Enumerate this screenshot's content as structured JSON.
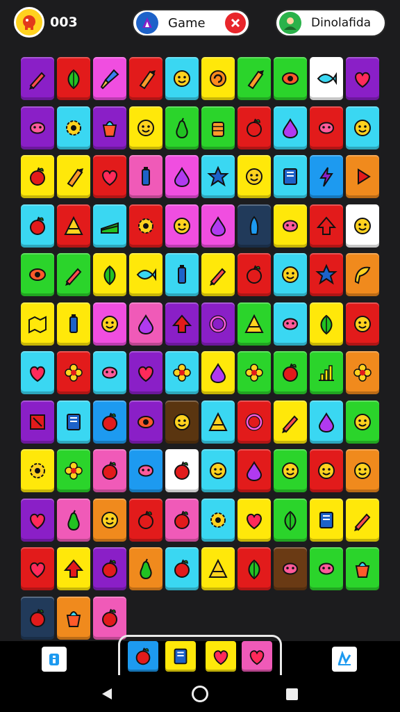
{
  "header": {
    "score": "003",
    "game_label": "Game",
    "user_label": "Dinolafida"
  },
  "palette": {
    "purple": "#8a1fc7",
    "red": "#e21b1b",
    "magenta": "#f04ee0",
    "cyan": "#3ad7f2",
    "yellow": "#ffe80a",
    "green": "#2bd42b",
    "white": "#ffffff",
    "blue": "#1d9af0",
    "orange": "#f08a1d",
    "pink": "#f05ab8",
    "dark": "#213a5a",
    "brown": "#5a3510",
    "olive": "#6a3a14"
  },
  "board": {
    "rows": [
      [
        [
          "purple",
          "pencil"
        ],
        [
          "red",
          "leaf"
        ],
        [
          "magenta",
          "brush"
        ],
        [
          "red",
          "crayon"
        ],
        [
          "cyan",
          "face"
        ],
        [
          "yellow",
          "swirl"
        ],
        [
          "green",
          "crayon"
        ],
        [
          "green",
          "eye"
        ],
        [
          "white",
          "fish"
        ],
        [
          "purple",
          "heart"
        ]
      ],
      [
        [
          "purple",
          "blob"
        ],
        [
          "cyan",
          "gear"
        ],
        [
          "purple",
          "pot"
        ],
        [
          "yellow",
          "face"
        ],
        [
          "green",
          "pear"
        ],
        [
          "green",
          "fist"
        ],
        [
          "red",
          "apple"
        ],
        [
          "cyan",
          "drop"
        ],
        [
          "red",
          "blob"
        ],
        [
          "cyan",
          "face"
        ]
      ],
      [
        [
          "yellow",
          "apple"
        ],
        [
          "yellow",
          "crayon"
        ],
        [
          "red",
          "heart"
        ],
        [
          "pink",
          "bottle"
        ],
        [
          "magenta",
          "drop"
        ],
        [
          "cyan",
          "star"
        ],
        [
          "yellow",
          "face"
        ],
        [
          "cyan",
          "book"
        ],
        [
          "blue",
          "bolt"
        ],
        [
          "orange",
          "play"
        ]
      ],
      [
        [
          "cyan",
          "apple"
        ],
        [
          "red",
          "cone"
        ],
        [
          "cyan",
          "cake"
        ],
        [
          "red",
          "gear"
        ],
        [
          "magenta",
          "face"
        ],
        [
          "magenta",
          "drop"
        ],
        [
          "dark",
          "rocket"
        ],
        [
          "yellow",
          "blob"
        ],
        [
          "red",
          "arrow"
        ],
        [
          "white",
          "face"
        ]
      ],
      [
        [
          "green",
          "eye"
        ],
        [
          "green",
          "pencil"
        ],
        [
          "yellow",
          "leaf"
        ],
        [
          "yellow",
          "fish"
        ],
        [
          "cyan",
          "bottle"
        ],
        [
          "yellow",
          "pencil"
        ],
        [
          "red",
          "apple"
        ],
        [
          "cyan",
          "face"
        ],
        [
          "red",
          "star"
        ],
        [
          "orange",
          "shell"
        ]
      ],
      [
        [
          "yellow",
          "map"
        ],
        [
          "yellow",
          "bottle"
        ],
        [
          "magenta",
          "face"
        ],
        [
          "pink",
          "drop"
        ],
        [
          "purple",
          "arrow"
        ],
        [
          "purple",
          "ring"
        ],
        [
          "green",
          "cone"
        ],
        [
          "cyan",
          "blob"
        ],
        [
          "yellow",
          "leaf"
        ],
        [
          "red",
          "face"
        ]
      ],
      [
        [
          "cyan",
          "heart"
        ],
        [
          "red",
          "flower"
        ],
        [
          "cyan",
          "blob"
        ],
        [
          "purple",
          "heart"
        ],
        [
          "cyan",
          "flower"
        ],
        [
          "yellow",
          "drop"
        ],
        [
          "green",
          "flower"
        ],
        [
          "green",
          "apple"
        ],
        [
          "green",
          "chart"
        ],
        [
          "orange",
          "flower"
        ]
      ],
      [
        [
          "purple",
          "box"
        ],
        [
          "cyan",
          "book"
        ],
        [
          "blue",
          "apple"
        ],
        [
          "purple",
          "eye"
        ],
        [
          "brown",
          "face"
        ],
        [
          "cyan",
          "cone"
        ],
        [
          "red",
          "ring"
        ],
        [
          "yellow",
          "pencil"
        ],
        [
          "cyan",
          "drop"
        ],
        [
          "green",
          "face"
        ]
      ],
      [
        [
          "yellow",
          "gear"
        ],
        [
          "green",
          "flower"
        ],
        [
          "pink",
          "apple"
        ],
        [
          "blue",
          "blob"
        ],
        [
          "white",
          "apple"
        ],
        [
          "cyan",
          "face"
        ],
        [
          "red",
          "drop"
        ],
        [
          "green",
          "face"
        ],
        [
          "red",
          "face"
        ],
        [
          "orange",
          "face"
        ]
      ],
      [
        [
          "purple",
          "heart"
        ],
        [
          "pink",
          "pear"
        ],
        [
          "orange",
          "face"
        ],
        [
          "red",
          "apple"
        ],
        [
          "pink",
          "apple"
        ],
        [
          "cyan",
          "gear"
        ],
        [
          "yellow",
          "heart"
        ],
        [
          "green",
          "leaf"
        ],
        [
          "yellow",
          "book"
        ],
        [
          "yellow",
          "pencil"
        ]
      ],
      [
        [
          "red",
          "heart"
        ],
        [
          "yellow",
          "arrow"
        ],
        [
          "purple",
          "apple"
        ],
        [
          "orange",
          "pear"
        ],
        [
          "cyan",
          "apple"
        ],
        [
          "yellow",
          "cone"
        ],
        [
          "red",
          "leaf"
        ],
        [
          "olive",
          "blob"
        ],
        [
          "green",
          "blob"
        ],
        [
          "green",
          "pot"
        ]
      ],
      [
        [
          "dark",
          "apple"
        ],
        [
          "orange",
          "pot"
        ],
        [
          "pink",
          "apple"
        ]
      ]
    ]
  },
  "hand": [
    [
      "blue",
      "apple"
    ],
    [
      "yellow",
      "book"
    ],
    [
      "yellow",
      "heart"
    ],
    [
      "pink",
      "heart"
    ]
  ],
  "buttons": {
    "left_icon": "hint-icon",
    "right_icon": "shuffle-icon"
  }
}
